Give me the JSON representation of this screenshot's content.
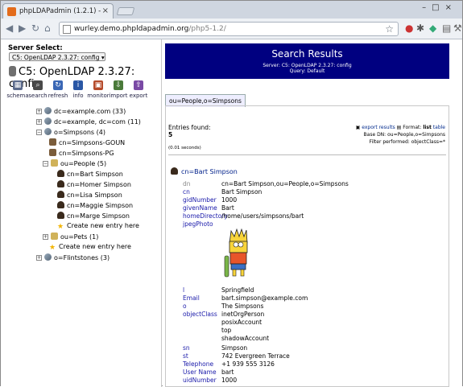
{
  "browser": {
    "tab_title": "phpLDAPadmin (1.2.1) -",
    "url_host": "wurley.demo.phpldapadmin.org",
    "url_path": "/php5-1.2/"
  },
  "left": {
    "server_select_label": "Server Select:",
    "server_select_value": "C5: OpenLDAP 2.3.27: config",
    "server_title": "C5: OpenLDAP 2.3.27: config",
    "tools": [
      {
        "label": "schema",
        "icon": "schema-icon",
        "color": "#5b6b8c"
      },
      {
        "label": "search",
        "icon": "search-icon",
        "color": "#4a4a4a"
      },
      {
        "label": "refresh",
        "icon": "refresh-icon",
        "color": "#3a67b5"
      },
      {
        "label": "info",
        "icon": "info-icon",
        "color": "#2a57a5"
      },
      {
        "label": "monitor",
        "icon": "monitor-icon",
        "color": "#b54a2a"
      },
      {
        "label": "import",
        "icon": "import-icon",
        "color": "#4a7a3a"
      },
      {
        "label": "export",
        "icon": "export-icon",
        "color": "#7a4aa5"
      }
    ],
    "tree": [
      {
        "label": "dc=example.com (33)",
        "type": "dc",
        "toggle": "+"
      },
      {
        "label": "dc=example, dc=com (11)",
        "type": "dc",
        "toggle": "+"
      },
      {
        "label": "o=Simpsons (4)",
        "type": "dc",
        "toggle": "-"
      },
      {
        "label": "cn=Simpsons-GOUN",
        "type": "grp",
        "toggle": ""
      },
      {
        "label": "cn=Simpsons-PG",
        "type": "grp",
        "toggle": ""
      },
      {
        "label": "ou=People (5)",
        "type": "ou",
        "toggle": "-"
      },
      {
        "label": "cn=Bart Simpson",
        "type": "person",
        "toggle": ""
      },
      {
        "label": "cn=Homer Simpson",
        "type": "person",
        "toggle": ""
      },
      {
        "label": "cn=Lisa Simpson",
        "type": "person",
        "toggle": ""
      },
      {
        "label": "cn=Maggie Simpson",
        "type": "person",
        "toggle": ""
      },
      {
        "label": "cn=Marge Simpson",
        "type": "person",
        "toggle": ""
      },
      {
        "label": "Create new entry here",
        "type": "star",
        "toggle": ""
      },
      {
        "label": "ou=Pets (1)",
        "type": "ou",
        "toggle": "+"
      },
      {
        "label": "Create new entry here",
        "type": "star",
        "toggle": ""
      },
      {
        "label": "o=Flintstones (3)",
        "type": "dc",
        "toggle": "+"
      }
    ]
  },
  "right": {
    "title": "Search Results",
    "server_line": "Server: C5: OpenLDAP 2.3.27: config",
    "query_line": "Query: Default",
    "tab": "ou=People,o=Simpsons",
    "entries_found_label": "Entries found:",
    "entries_found_value": "5",
    "seconds": "(0.01 seconds)",
    "export_results": "export results",
    "format_label": "Format:",
    "format_list": "list",
    "format_table": "table",
    "base_dn": "Base DN: ou=People,o=Simpsons",
    "filter": "Filter performed: objectClass=*",
    "entry": {
      "title": "cn=Bart Simpson",
      "attrs": [
        {
          "name": "dn",
          "value": "cn=Bart Simpson,ou=People,o=Simpsons",
          "dim": true
        },
        {
          "name": "cn",
          "value": "Bart Simpson"
        },
        {
          "name": "gidNumber",
          "value": "1000"
        },
        {
          "name": "givenName",
          "value": "Bart"
        },
        {
          "name": "homeDirectory",
          "value": "/home/users/simpsons/bart"
        },
        {
          "name": "jpegPhoto",
          "value": ""
        },
        {
          "name": "l",
          "value": "Springfield"
        },
        {
          "name": "Email",
          "value": "bart.simpson@example.com"
        },
        {
          "name": "o",
          "value": "The Simpsons"
        },
        {
          "name": "objectClass",
          "value": "inetOrgPerson"
        },
        {
          "name": "",
          "value": "posixAccount"
        },
        {
          "name": "",
          "value": "top"
        },
        {
          "name": "",
          "value": "shadowAccount"
        },
        {
          "name": "sn",
          "value": "Simpson"
        },
        {
          "name": "st",
          "value": "742 Evergreen Terrace"
        },
        {
          "name": "Telephone",
          "value": "+1 939 555 3126"
        },
        {
          "name": "User Name",
          "value": "bart"
        },
        {
          "name": "uidNumber",
          "value": "1000"
        }
      ]
    }
  }
}
